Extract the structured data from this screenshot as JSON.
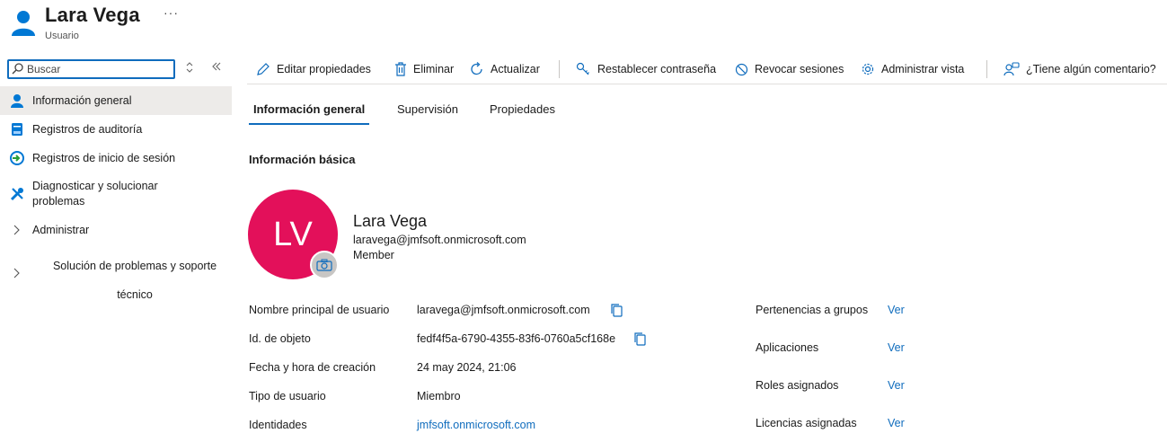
{
  "header": {
    "title": "Lara Vega",
    "subtitle": "Usuario",
    "more": "···",
    "icon": "user-icon"
  },
  "sidebar": {
    "search_placeholder": "Buscar",
    "items": [
      {
        "label": "Información general",
        "icon": "user-icon",
        "active": true
      },
      {
        "label": "Registros de auditoría",
        "icon": "audit-log-icon"
      },
      {
        "label": "Registros de inicio de sesión",
        "icon": "sign-in-log-icon"
      },
      {
        "label": "Diagnosticar y solucionar problemas",
        "icon": "wrench-icon"
      },
      {
        "label": "Administrar",
        "icon": "chevron-right-icon"
      },
      {
        "label": "Solución de problemas y soporte técnico",
        "icon": "chevron-right-icon"
      }
    ]
  },
  "toolbar": {
    "edit": "Editar propiedades",
    "delete": "Eliminar",
    "refresh": "Actualizar",
    "reset_password": "Restablecer contraseña",
    "revoke": "Revocar sesiones",
    "manage_view": "Administrar vista",
    "feedback": "¿Tiene algún comentario?"
  },
  "tabs": [
    "Información general",
    "Supervisión",
    "Propiedades"
  ],
  "basic_info": {
    "section_title": "Información básica",
    "initials": "LV",
    "name": "Lara Vega",
    "email": "laravega@jmfsoft.onmicrosoft.com",
    "member_type": "Member"
  },
  "properties": [
    {
      "label": "Nombre principal de usuario",
      "value": "laravega@jmfsoft.onmicrosoft.com"
    },
    {
      "label": "Id. de objeto",
      "value": "fedf4f5a-6790-4355-83f6-0760a5cf168e"
    },
    {
      "label": "Fecha y hora de creación",
      "value": "24 may 2024, 21:06"
    },
    {
      "label": "Tipo de usuario",
      "value": "Miembro"
    },
    {
      "label": "Identidades",
      "value": "jmfsoft.onmicrosoft.com"
    }
  ],
  "related": [
    {
      "label": "Pertenencias a grupos",
      "link": "Ver"
    },
    {
      "label": "Aplicaciones",
      "link": "Ver"
    },
    {
      "label": "Roles asignados",
      "link": "Ver"
    },
    {
      "label": "Licencias asignadas",
      "link": "Ver"
    }
  ],
  "colors": {
    "accent": "#0f6cbd",
    "avatar": "#e3105a",
    "active_nav": "#edebe9"
  }
}
